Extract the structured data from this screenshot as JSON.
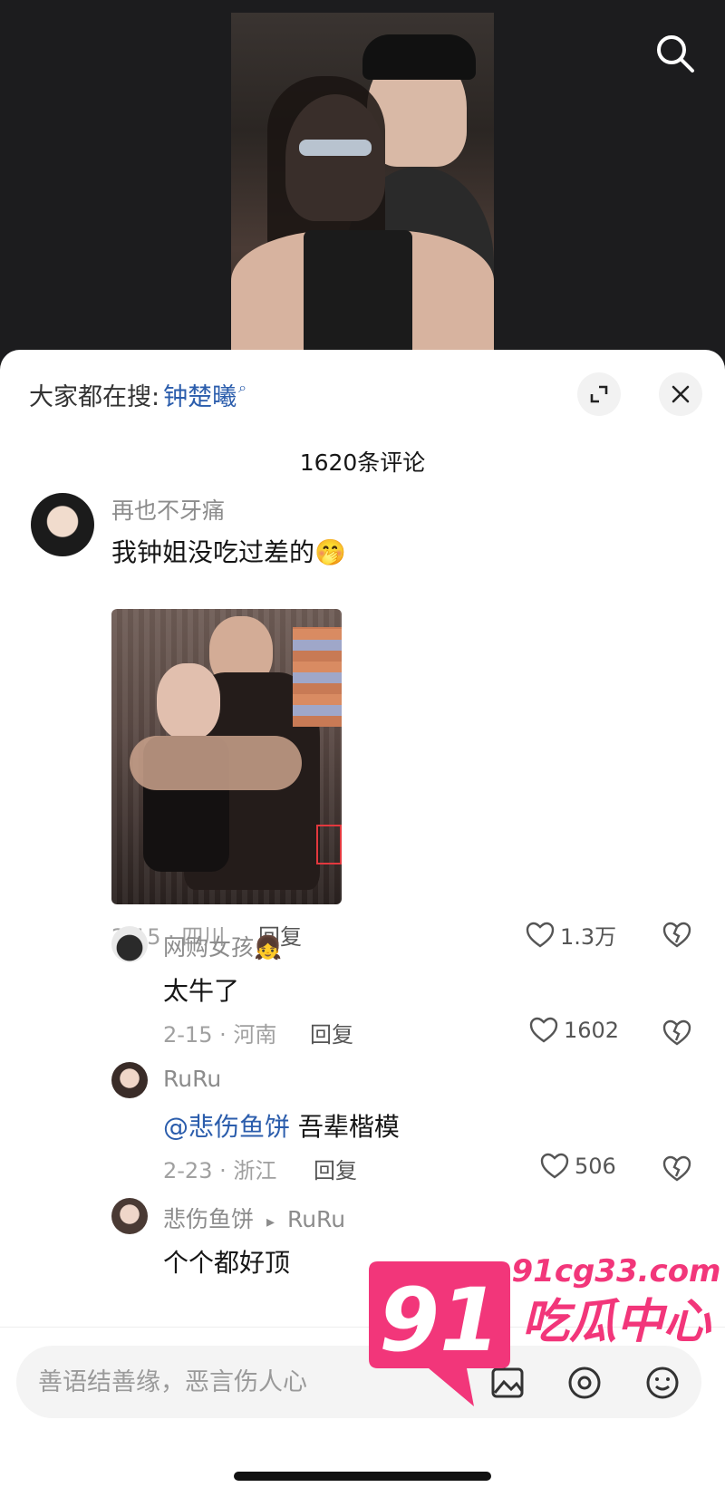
{
  "search_hint": {
    "prefix": "大家都在搜:",
    "keyword": "钟楚曦"
  },
  "comment_count": "1620条评论",
  "comments": [
    {
      "user": "再也不牙痛",
      "text": "我钟姐没吃过差的",
      "emoji": "🤭",
      "date_location": "2-15 · 四川",
      "reply_label": "回复",
      "likes": "1.3万"
    }
  ],
  "replies": [
    {
      "user": "网购女孩",
      "emoji": "👧",
      "text": "太牛了",
      "date_location": "2-15 · 河南",
      "reply_label": "回复",
      "likes": "1602"
    },
    {
      "user": "RuRu",
      "mention": "@悲伤鱼饼",
      "text": " 吾辈楷模",
      "date_location": "2-23 · 浙江",
      "reply_label": "回复",
      "likes": "506"
    },
    {
      "user": "悲伤鱼饼",
      "reply_to_arrow": "▸",
      "reply_to": "RuRu",
      "text": "个个都好顶"
    }
  ],
  "input": {
    "placeholder": "善语结善缘，恶言伤人心"
  },
  "watermark": {
    "domain": "91cg33.com",
    "brand": "吃瓜中心",
    "number": "91"
  },
  "colors": {
    "link": "#2b5dac",
    "watermark": "#f2367a"
  }
}
